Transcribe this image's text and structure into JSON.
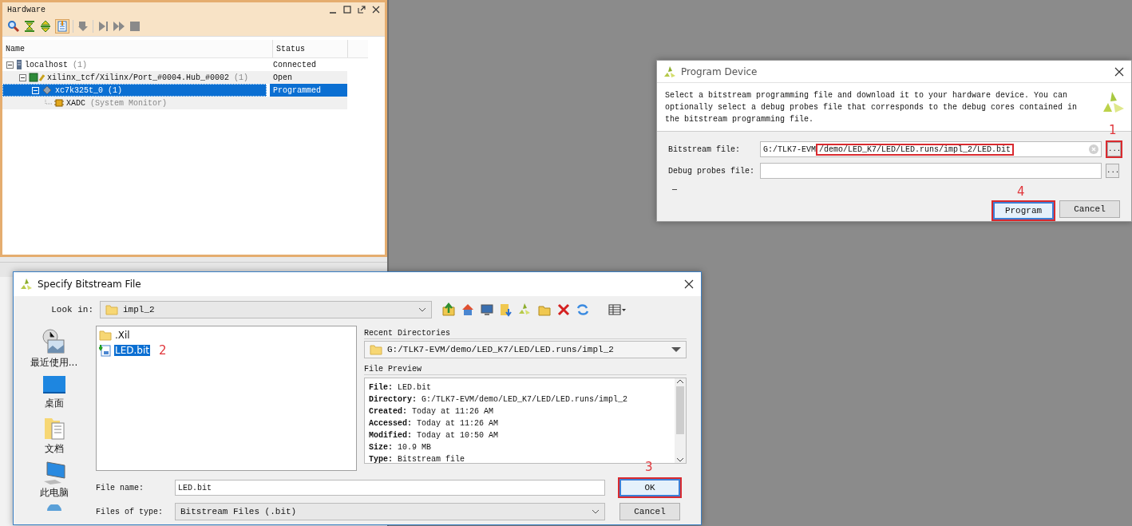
{
  "hardware_panel": {
    "title": "Hardware",
    "columns": [
      "Name",
      "Status"
    ],
    "tree": [
      {
        "name": "localhost",
        "count": "(1)",
        "status": "Connected",
        "kind": "host",
        "expanded": true,
        "selected": false,
        "children": [
          {
            "name": "xilinx_tcf/Xilinx/Port_#0004.Hub_#0002",
            "count": "(1)",
            "status": "Open",
            "kind": "target",
            "expanded": true,
            "selected": false,
            "children": [
              {
                "name": "xc7k325t_0",
                "count": "(1)",
                "status": "Programmed",
                "kind": "device",
                "expanded": true,
                "selected": true,
                "children": [
                  {
                    "name": "XADC",
                    "count": "(System Monitor)",
                    "kind": "monitor",
                    "selected": false
                  }
                ]
              }
            ]
          }
        ]
      }
    ]
  },
  "program_device_dialog": {
    "title": "Program Device",
    "description": "Select a bitstream programming file and download it to your hardware device. You can optionally select a debug probes file that corresponds to the debug cores contained in the bitstream programming file.",
    "fields": [
      {
        "label": "Bitstream file:",
        "value": "G:/TLK7-EVM",
        "highlighted_value": "/demo/LED_K7/LED/LED.runs/impl_2/LED.bit",
        "clearable": true,
        "browse_label": "...",
        "annotation": "1"
      },
      {
        "label": "Debug probes file:",
        "clearable": false,
        "browse_label": "..."
      }
    ],
    "note": "—",
    "buttons": [
      {
        "label": "Program",
        "default": true,
        "annotation": "4"
      },
      {
        "label": "Cancel",
        "default": false
      }
    ]
  },
  "bitstream_dialog": {
    "title": "Specify Bitstream File",
    "look_in_label": "Look in:",
    "look_in": "impl_2",
    "places": [
      {
        "label": "最近使用...",
        "kind": "recent"
      },
      {
        "label": "桌面",
        "kind": "desktop"
      },
      {
        "label": "文档",
        "kind": "documents"
      },
      {
        "label": "此电脑",
        "kind": "computer"
      },
      {
        "kind": "network"
      }
    ],
    "files": [
      {
        "name": ".Xil",
        "kind": "folder",
        "selected": false
      },
      {
        "name": "LED.bit",
        "kind": "bitstream",
        "selected": true,
        "annotation": "2"
      }
    ],
    "recent_directories_label": "Recent Directories",
    "recent_directory": "G:/TLK7-EVM/demo/LED_K7/LED/LED.runs/impl_2",
    "file_preview_label": "File Preview",
    "preview_lines": [
      "**File:** LED.bit",
      "**Directory:** G:/TLK7-EVM/demo/LED_K7/LED/LED.runs/impl_2",
      "**Created:** Today at 11:26 AM",
      "**Accessed:** Today at 11:26 AM",
      "**Modified:** Today at 10:50 AM",
      "**Size:** 10.9 MB",
      "**Type:** Bitstream file"
    ],
    "file_name_label": "File name:",
    "file_name": "LED.bit",
    "file_type_label": "Files of type:",
    "file_type": "Bitstream Files (.bit)",
    "buttons": [
      {
        "label": "OK",
        "default": true,
        "annotation": "3"
      },
      {
        "label": "Cancel",
        "default": false
      }
    ]
  }
}
